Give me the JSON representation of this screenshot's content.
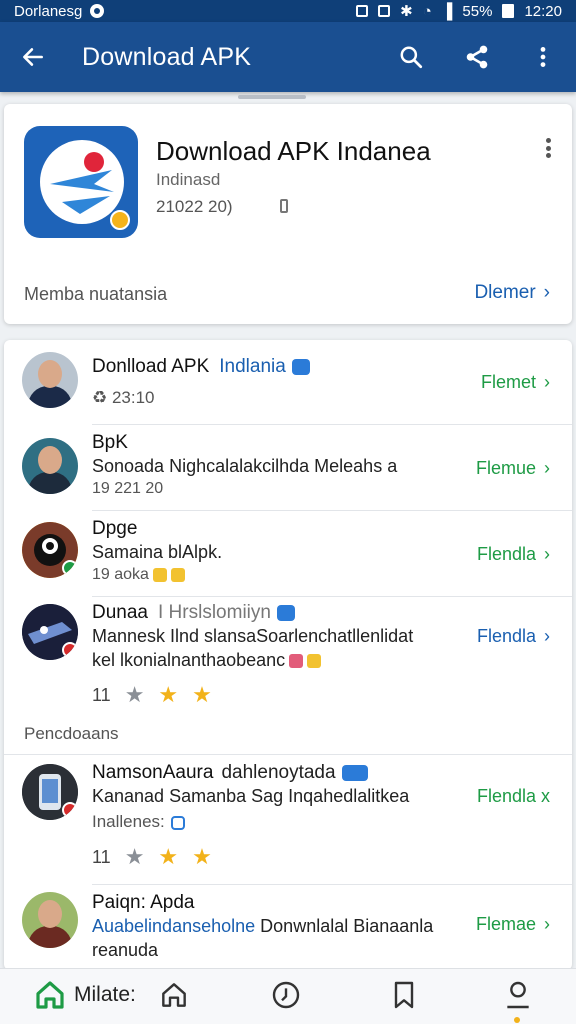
{
  "status_bar": {
    "carrier": "Dorlanesg",
    "battery": "55%",
    "time": "12:20",
    "icons": [
      "location-icon",
      "nfc-icon",
      "screenshot-icon",
      "bluetooth-icon",
      "wifi-icon",
      "signal-icon",
      "battery-icon"
    ]
  },
  "app_bar": {
    "title": "Download APK",
    "icons": [
      "back-arrow-icon",
      "search-icon",
      "share-icon",
      "overflow-menu-icon"
    ]
  },
  "hero": {
    "app_name": "Download APK Indanea",
    "developer": "Indinasd",
    "meta": "21022 20)",
    "footer_label": "Memba nuatansia",
    "footer_link": "Dlemer"
  },
  "list": {
    "rows": [
      {
        "title": "Donlload APK",
        "title_highlight": "Indlania",
        "line1": "♻ 23:10",
        "action": "Flemet"
      },
      {
        "title": "BpK",
        "line1": "Sonoada Nighcalalakcilhda Meleahs a",
        "line2": "19 221 20",
        "action": "Flemue"
      },
      {
        "title": "Dpge",
        "line1": "Samaina blAlpk.",
        "line2": "19 aoka",
        "action": "Flendla"
      },
      {
        "title": "Dunaa",
        "title_muted": "I Hrslslomiiyn",
        "line1": "Mannesk Ilnd slansaSoarlenchatllenlidat",
        "line2": "kel lkonialnanthaobeanc",
        "rating": "11",
        "action": "Flendla"
      },
      {
        "title": "NamsonAaura",
        "title_muted": "dahlenoytada",
        "line1": "Kananad Samanba Sag Inqahedlalitkea",
        "line2": "Inallenes:",
        "rating": "11",
        "action": "Flendla x"
      },
      {
        "title": "Paiqn: Apda",
        "line1_highlight": "Auabelindanseholne",
        "line1": "Donwnlalal Bianaanla",
        "line2": "reanuda",
        "action": "Flemae"
      }
    ],
    "section_label": "Pencdoaans"
  },
  "bottom_nav": {
    "home_label": "Milate:",
    "icons": [
      "home-filled-icon",
      "home-outline-icon",
      "history-icon",
      "bookmark-icon",
      "profile-icon"
    ]
  },
  "colors": {
    "app_bar": "#1a4f91",
    "status_bar": "#0f3f78",
    "link_blue": "#1a5fb0",
    "action_green": "#1e9b45",
    "star_gold": "#f2b21a"
  }
}
